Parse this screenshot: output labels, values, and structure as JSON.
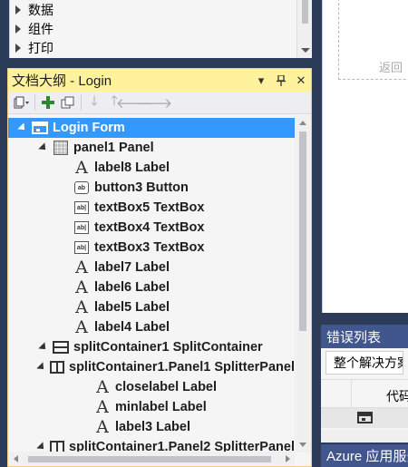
{
  "toolbox": {
    "items": [
      {
        "label": "数据"
      },
      {
        "label": "组件"
      },
      {
        "label": "打印"
      }
    ]
  },
  "designer": {
    "back_text": "返回"
  },
  "outline": {
    "title": "文档大纲 - Login",
    "toolbar": {
      "icons": [
        "view-dropdown-icon",
        "add-icon",
        "copy-icon",
        "move-down-icon",
        "move-up-icon",
        "move-left-icon",
        "move-right-icon"
      ]
    },
    "tree": [
      {
        "label": "Login  Form",
        "selected": true
      },
      {
        "label": "panel1  Panel"
      },
      {
        "label": "label8  Label"
      },
      {
        "label": "button3  Button"
      },
      {
        "label": "textBox5  TextBox"
      },
      {
        "label": "textBox4  TextBox"
      },
      {
        "label": "textBox3  TextBox"
      },
      {
        "label": "label7  Label"
      },
      {
        "label": "label6  Label"
      },
      {
        "label": "label5  Label"
      },
      {
        "label": "label4  Label"
      },
      {
        "label": "splitContainer1  SplitContainer"
      },
      {
        "label": "splitContainer1.Panel1  SplitterPanel"
      },
      {
        "label": "closelabel  Label"
      },
      {
        "label": "minlabel  Label"
      },
      {
        "label": "label3  Label"
      },
      {
        "label": "splitContainer1.Panel2  SplitterPanel"
      }
    ]
  },
  "error_list": {
    "title": "错误列表",
    "scope": "整个解决方案",
    "col_code": "代码"
  },
  "azure": {
    "title": "Azure 应用服务"
  }
}
